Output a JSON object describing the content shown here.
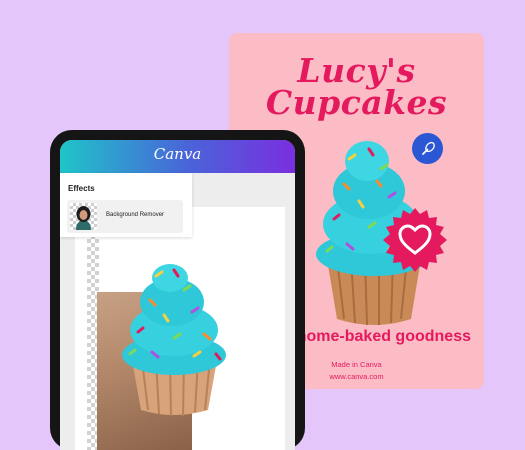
{
  "poster": {
    "title_line1": "Lucy's",
    "title_line2": "Cupcakes",
    "tagline": "sh home-baked goodness",
    "made_in": "Made in Canva",
    "url": "www.canva.com"
  },
  "editor": {
    "logo": "Canva",
    "effects_title": "Effects",
    "bg_remover_label": "Background Remover"
  },
  "colors": {
    "page_bg": "#e4c6fb",
    "poster_bg": "#fbbcc6",
    "accent_pink": "#e4195e",
    "accent_blue": "#2b56d4",
    "frosting": "#2ec8d8"
  },
  "icons": [
    "whisk-icon",
    "heart-icon"
  ]
}
